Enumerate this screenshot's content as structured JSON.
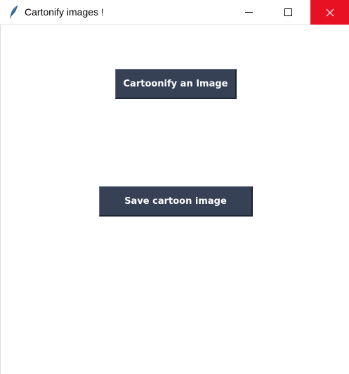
{
  "window": {
    "title": "Cartonify images !",
    "icon": "feather-icon",
    "controls": {
      "minimize": "minimize-icon",
      "maximize": "maximize-icon",
      "close": "close-icon"
    }
  },
  "main": {
    "cartoonify_button_label": "Cartoonify an Image",
    "save_button_label": "Save cartoon image"
  },
  "colors": {
    "button_bg": "#364156",
    "button_text": "#ffffff",
    "close_hover": "#e81123"
  }
}
